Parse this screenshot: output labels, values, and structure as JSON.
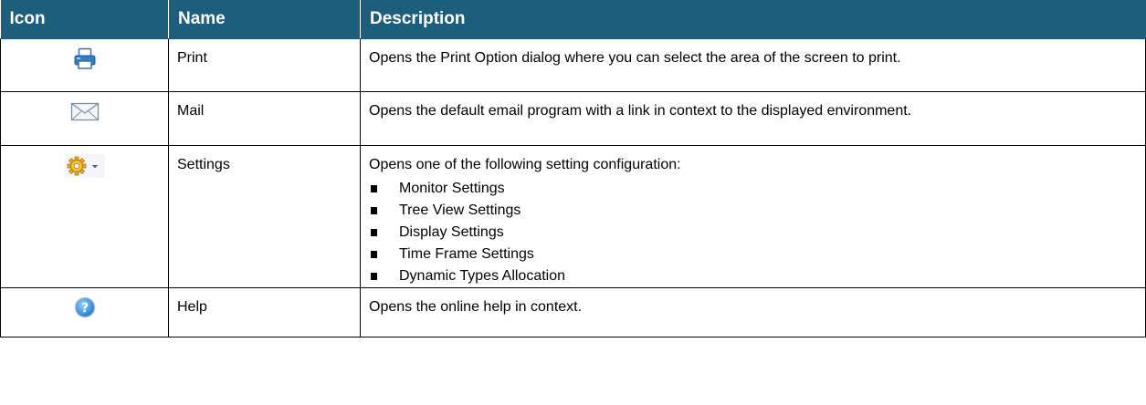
{
  "headers": {
    "icon": "Icon",
    "name": "Name",
    "description": "Description"
  },
  "rows": [
    {
      "icon": "printer-icon",
      "name": "Print",
      "description": "Opens the Print Option dialog where you can select the area of the screen to print."
    },
    {
      "icon": "mail-envelope-icon",
      "name": "Mail",
      "description": "Opens the default email program with a link in context to the displayed environment."
    },
    {
      "icon": "gear-dropdown-icon",
      "name": "Settings",
      "description": "Opens one of the following setting configuration:",
      "bullets": [
        "Monitor Settings",
        "Tree View Settings",
        "Display Settings",
        "Time Frame Settings",
        "Dynamic Types Allocation"
      ]
    },
    {
      "icon": "help-question-icon",
      "name": "Help",
      "description": "Opens the online help in context."
    }
  ],
  "colors": {
    "header_background": "#1c5e7b",
    "header_text": "#ffffff",
    "border": "#000000"
  }
}
